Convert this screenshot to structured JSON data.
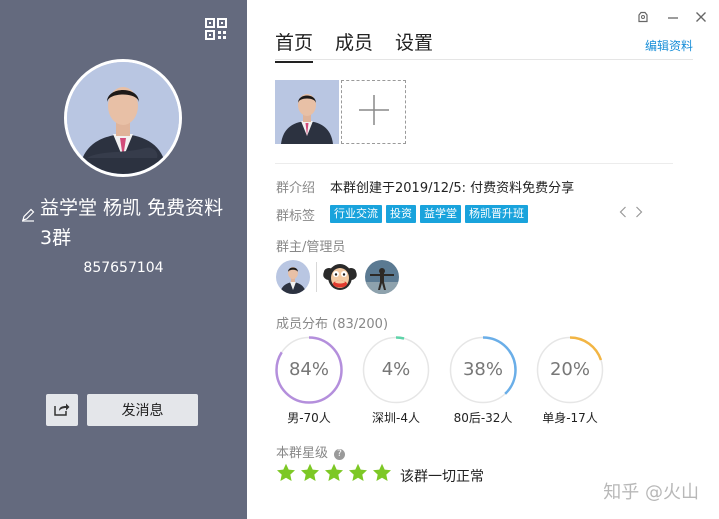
{
  "left": {
    "group_name": "益学堂 杨凯 免费资料3群",
    "group_id": "857657104",
    "send_button": "发消息"
  },
  "tabs": [
    {
      "label": "首页",
      "active": true
    },
    {
      "label": "成员",
      "active": false
    },
    {
      "label": "设置",
      "active": false
    }
  ],
  "edit_link": "编辑资料",
  "intro": {
    "label": "群介绍",
    "value": "本群创建于2019/12/5: 付费资料免费分享"
  },
  "tags": {
    "label": "群标签",
    "items": [
      "行业交流",
      "投资",
      "益学堂",
      "杨凯晋升班"
    ]
  },
  "admins": {
    "label": "群主/管理员"
  },
  "distribution": {
    "label": "成员分布 (83/200)",
    "stats": [
      {
        "percent_text": "84%",
        "fraction": 0.84,
        "color": "#b48fdc",
        "label": "男-70人"
      },
      {
        "percent_text": "4%",
        "fraction": 0.04,
        "color": "#5fd3a9",
        "label": "深圳-4人"
      },
      {
        "percent_text": "38%",
        "fraction": 0.38,
        "color": "#6aaee8",
        "label": "80后-32人"
      },
      {
        "percent_text": "20%",
        "fraction": 0.2,
        "color": "#f2b544",
        "label": "单身-17人"
      }
    ]
  },
  "rating": {
    "label": "本群星级",
    "stars": 5,
    "status": "该群一切正常"
  },
  "watermark": "知乎 @火山",
  "colors": {
    "left_bg": "#646a7e",
    "link": "#1a8fd8",
    "tag_bg": "#19a3dc",
    "star": "#7dc825"
  }
}
